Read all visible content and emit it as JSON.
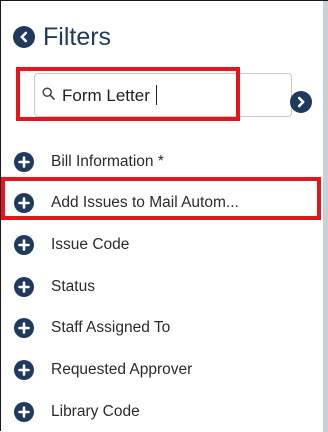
{
  "header": {
    "title": "Filters",
    "back_icon": "chevron-left-circle-icon"
  },
  "search": {
    "value": "Form Letter",
    "icon": "search-icon",
    "go_icon": "chevron-right-circle-icon"
  },
  "filters": {
    "items": [
      {
        "label": "Bill Information *"
      },
      {
        "label": "Add Issues to Mail Autom..."
      },
      {
        "label": "Issue Code"
      },
      {
        "label": "Status"
      },
      {
        "label": "Staff Assigned To"
      },
      {
        "label": "Requested Approver"
      },
      {
        "label": "Library Code"
      }
    ]
  },
  "colors": {
    "accent": "#1f3a5c",
    "highlight": "#e8141b"
  }
}
